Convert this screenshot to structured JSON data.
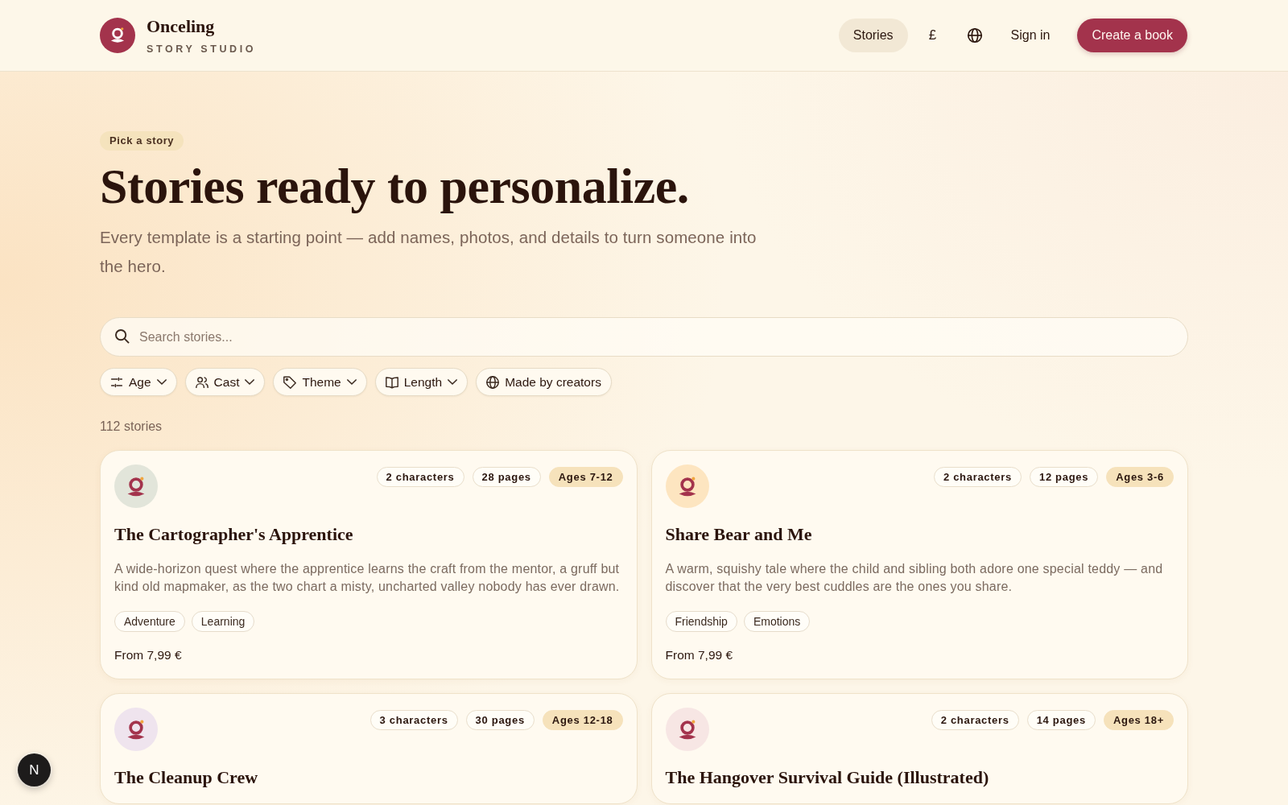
{
  "header": {
    "brand": {
      "name": "Onceling",
      "tagline": "STORY STUDIO"
    },
    "nav": [
      {
        "label": "Stories",
        "selected": true
      }
    ],
    "currency": "£",
    "sign_in": "Sign in",
    "cta": "Create a book"
  },
  "hero": {
    "eyebrow": "Pick a story",
    "title": "Stories ready to personalize.",
    "subtitle": "Every template is a starting point — add names, photos, and details to turn someone into the hero."
  },
  "search": {
    "placeholder": "Search stories..."
  },
  "filters": [
    {
      "label": "Age",
      "kind": "age",
      "dropdown": true
    },
    {
      "label": "Cast",
      "kind": "cast",
      "dropdown": true
    },
    {
      "label": "Theme",
      "kind": "theme",
      "dropdown": true
    },
    {
      "label": "Length",
      "kind": "length",
      "dropdown": true
    },
    {
      "label": "Made by creators",
      "kind": "creators",
      "dropdown": false
    }
  ],
  "result_count": "112 stories",
  "stories": [
    {
      "color": "#e2e5da",
      "meta": [
        {
          "label": "2 characters",
          "kind": "count"
        },
        {
          "label": "28 pages",
          "kind": "count"
        },
        {
          "label": "Ages 7-12",
          "kind": "age"
        }
      ],
      "title": "The Cartographer's Apprentice",
      "description": "A wide-horizon quest where the apprentice learns the craft from the mentor, a gruff but kind old mapmaker, as the two chart a misty, uncharted valley nobody has ever drawn.",
      "themes": [
        "Adventure",
        "Learning"
      ],
      "price": "From 7,99 €"
    },
    {
      "color": "#fde5c0",
      "meta": [
        {
          "label": "2 characters",
          "kind": "count"
        },
        {
          "label": "12 pages",
          "kind": "count"
        },
        {
          "label": "Ages 3-6",
          "kind": "age"
        }
      ],
      "title": "Share Bear and Me",
      "description": "A warm, squishy tale where the child and sibling both adore one special teddy — and discover that the very best cuddles are the ones you share.",
      "themes": [
        "Friendship",
        "Emotions"
      ],
      "price": "From 7,99 €"
    },
    {
      "color": "#efe4ee",
      "meta": [
        {
          "label": "3 characters",
          "kind": "count"
        },
        {
          "label": "30 pages",
          "kind": "count"
        },
        {
          "label": "Ages 12-18",
          "kind": "age"
        }
      ],
      "title": "The Cleanup Crew"
    },
    {
      "color": "#f7e6e4",
      "meta": [
        {
          "label": "2 characters",
          "kind": "count"
        },
        {
          "label": "14 pages",
          "kind": "count"
        },
        {
          "label": "Ages 18+",
          "kind": "age"
        }
      ],
      "title": "The Hangover Survival Guide (Illustrated)"
    }
  ],
  "dev_badge": {
    "label": "N"
  }
}
